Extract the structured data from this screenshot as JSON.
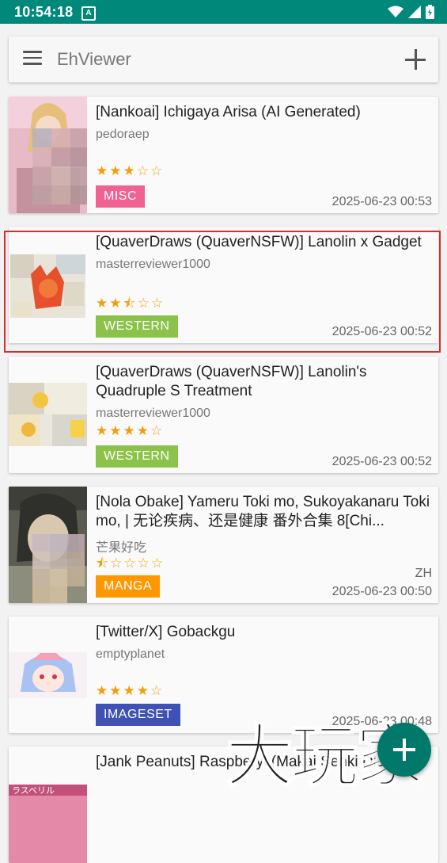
{
  "status_bar": {
    "time": "10:54:18",
    "notification_icon": "A"
  },
  "search_bar": {
    "title": "EhViewer"
  },
  "gallery_list": [
    {
      "title": "[Nankoai] Ichigaya Arisa (AI Generated)",
      "uploader": "pedoraep",
      "rating_stars": "★★★☆☆",
      "rating": 3,
      "category": "MISC",
      "category_color": "#f06292",
      "language": "",
      "date": "2025-06-23 00:53"
    },
    {
      "title": "[QuaverDraws (QuaverNSFW)] Lanolin x Gadget",
      "uploader": "masterreviewer1000",
      "rating_stars": "★★⯪☆☆",
      "rating": 2.5,
      "category": "WESTERN",
      "category_color": "#8bc34a",
      "language": "",
      "date": "2025-06-23 00:52"
    },
    {
      "title": "[QuaverDraws (QuaverNSFW)] Lanolin's Quadruple S Treatment",
      "uploader": "masterreviewer1000",
      "rating_stars": "★★★★☆",
      "rating": 4,
      "category": "WESTERN",
      "category_color": "#8bc34a",
      "language": "",
      "date": "2025-06-23 00:52"
    },
    {
      "title": "[Nola Obake] Yameru Toki mo, Sukoyakanaru Toki mo, | 无论疾病、还是健康 番外合集 8[Chi...",
      "uploader": "芒果好吃",
      "rating_stars": "⯪☆☆☆☆",
      "rating": 0.5,
      "category": "MANGA",
      "category_color": "#ff9800",
      "language": "ZH",
      "date": "2025-06-23 00:50"
    },
    {
      "title": "[Twitter/X] Gobackgu",
      "uploader": "emptyplanet",
      "rating_stars": "★★★★☆",
      "rating": 4,
      "category": "IMAGESET",
      "category_color": "#3f51b5",
      "language": "",
      "date": "2025-06-23 00:48"
    },
    {
      "title": "[Jank Peanuts] Raspberyl (Makai Senki Disgaea)",
      "uploader": "",
      "rating_stars": "",
      "category": "",
      "category_color": "",
      "language": "",
      "date": ""
    }
  ],
  "fab": {
    "icon": "plus-icon"
  },
  "watermark": {
    "text": "大玩家"
  },
  "colors": {
    "status_bar": "#00897b",
    "star": "#f29e0c",
    "highlight": "#d32f2f",
    "fab": "#00796b"
  }
}
